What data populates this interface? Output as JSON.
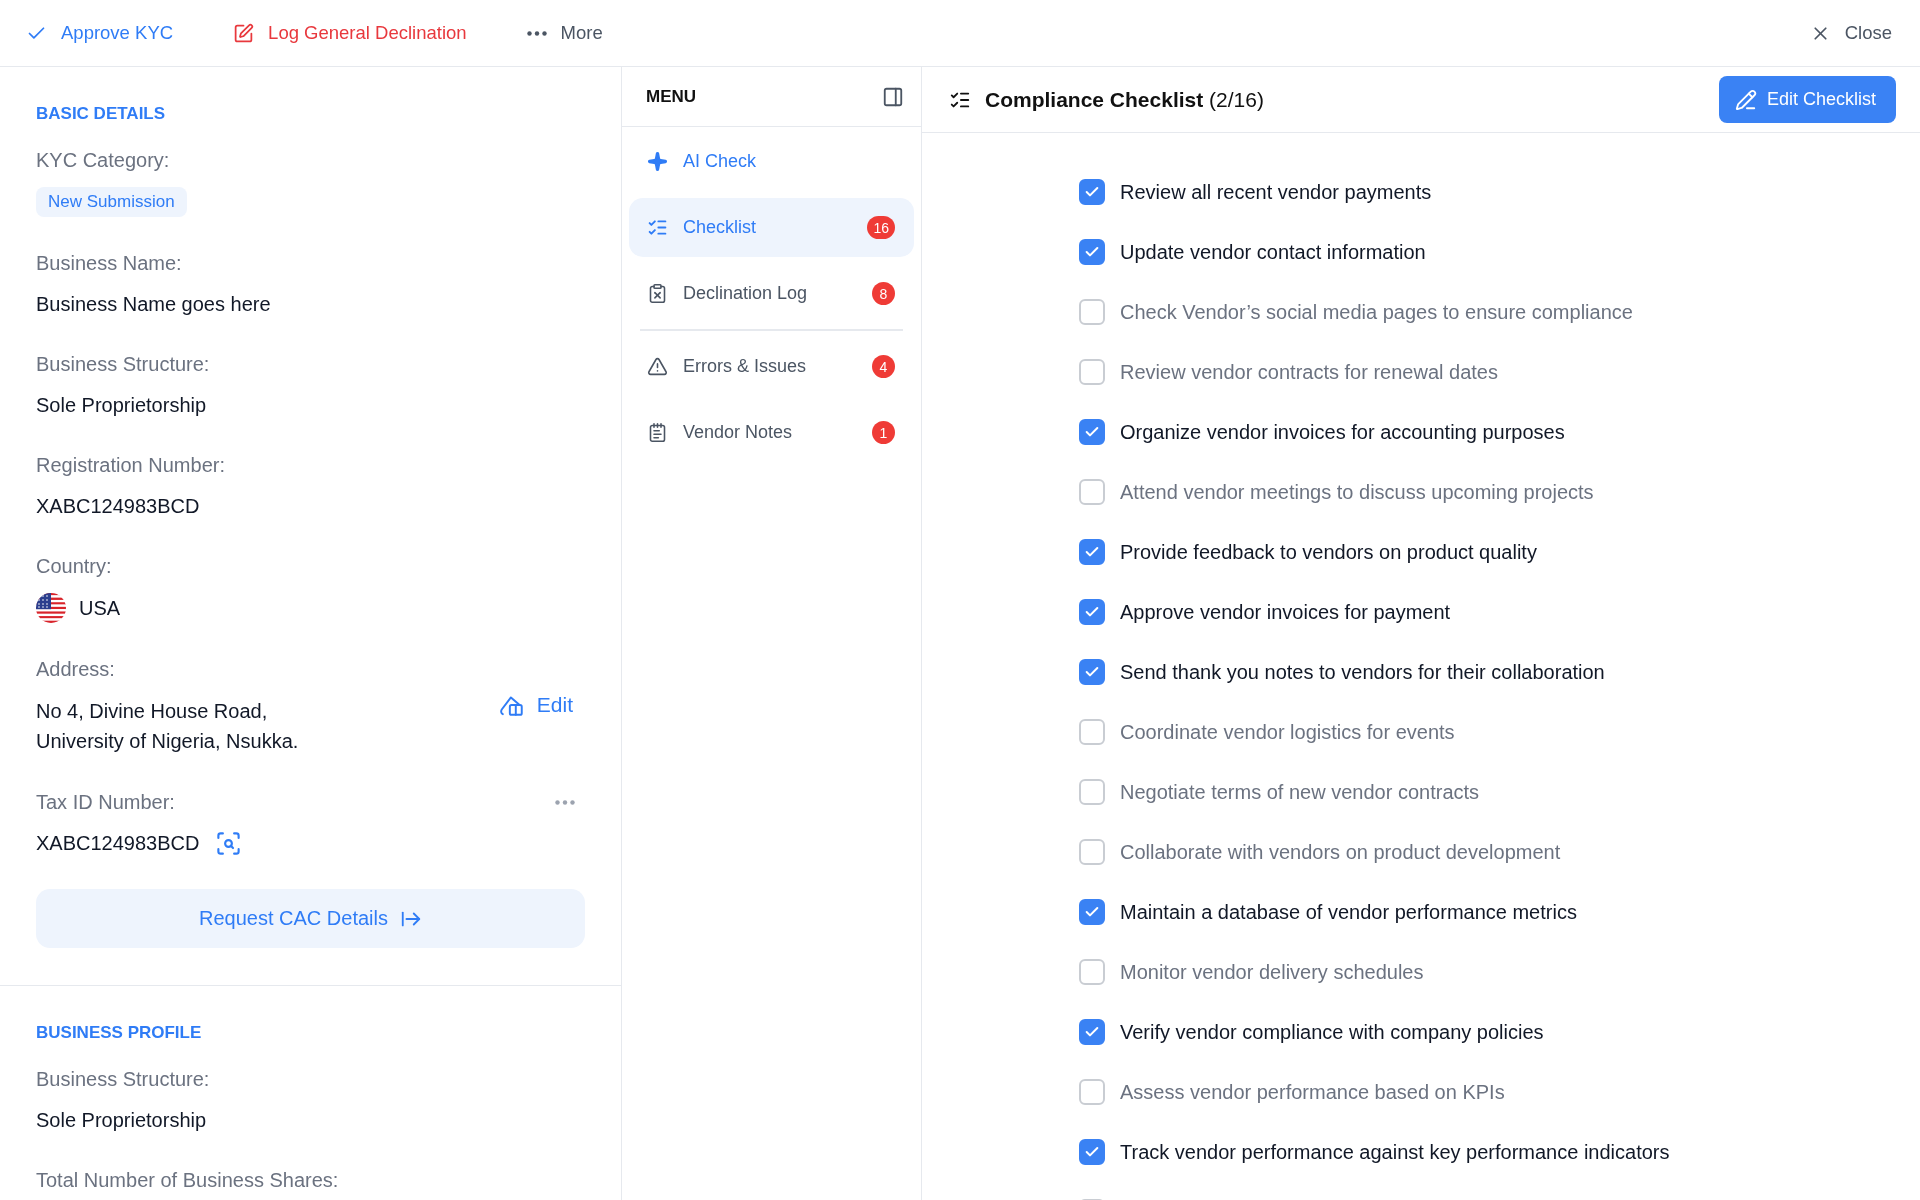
{
  "toolbar": {
    "actions": [
      {
        "kind": "approve",
        "label": "Approve KYC"
      },
      {
        "kind": "decline",
        "label": "Log General Declination"
      },
      {
        "kind": "more",
        "label": "More"
      }
    ],
    "close": "Close"
  },
  "details": {
    "sections": [
      {
        "title": "BASIC DETAILS",
        "fields": [
          {
            "kind": "badge",
            "label": "KYC Category:",
            "value": "New Submission"
          },
          {
            "kind": "text",
            "label": "Business Name:",
            "value": "Business Name goes here"
          },
          {
            "kind": "text",
            "label": "Business Structure:",
            "value": "Sole Proprietorship"
          },
          {
            "kind": "text",
            "label": "Registration Number:",
            "value": "XABC124983BCD"
          },
          {
            "kind": "country",
            "label": "Country:",
            "value": "USA"
          },
          {
            "kind": "address",
            "label": "Address:",
            "lines": [
              "No 4, Divine House Road,",
              "University of Nigeria, Nsukka."
            ],
            "action": "Edit"
          },
          {
            "kind": "tax",
            "label": "Tax ID Number:",
            "value": "XABC124983BCD"
          }
        ],
        "button": "Request CAC Details"
      },
      {
        "title": "BUSINESS PROFILE",
        "fields": [
          {
            "kind": "text",
            "label": "Business Structure:",
            "value": "Sole Proprietorship"
          },
          {
            "kind": "text",
            "label": "Total Number of Business Shares:"
          }
        ]
      }
    ]
  },
  "menu": {
    "title": "MENU",
    "groups": [
      [
        {
          "kind": "ai",
          "label": "AI Check",
          "selected": false
        },
        {
          "kind": "checklist",
          "label": "Checklist",
          "count": "16",
          "selected": true
        },
        {
          "kind": "declination",
          "label": "Declination Log",
          "count": "8",
          "selected": false
        }
      ],
      [
        {
          "kind": "errors",
          "label": "Errors & Issues",
          "count": "4",
          "selected": false
        },
        {
          "kind": "notes",
          "label": "Vendor Notes",
          "count": "1",
          "selected": false
        }
      ]
    ]
  },
  "checklist": {
    "title": "**Compliance Checklist** (2/16)",
    "edit_button": "Edit Checklist",
    "items": [
      {
        "label": "Review all recent vendor payments",
        "checked": true
      },
      {
        "label": "Update vendor contact information",
        "checked": true
      },
      {
        "label": "Check Vendor’s social media pages to ensure compliance",
        "checked": false
      },
      {
        "label": "Review vendor contracts for renewal dates",
        "checked": false
      },
      {
        "label": "Organize vendor invoices for accounting purposes",
        "checked": true
      },
      {
        "label": "Attend vendor meetings to discuss upcoming projects",
        "checked": false
      },
      {
        "label": "Provide feedback to vendors on product quality",
        "checked": true
      },
      {
        "label": "Approve vendor invoices for payment",
        "checked": true
      },
      {
        "label": "Send thank you notes to vendors for their collaboration",
        "checked": true
      },
      {
        "label": "Coordinate vendor logistics for events",
        "checked": false
      },
      {
        "label": "Negotiate terms of new vendor contracts",
        "checked": false
      },
      {
        "label": "Collaborate with vendors on product development",
        "checked": false
      },
      {
        "label": "Maintain a database of vendor performance metrics",
        "checked": true
      },
      {
        "label": "Monitor vendor delivery schedules",
        "checked": false
      },
      {
        "label": "Verify vendor compliance with company policies",
        "checked": true
      },
      {
        "label": "Assess vendor performance based on KPIs",
        "checked": false
      },
      {
        "label": "Track vendor performance against key performance indicators",
        "checked": true
      },
      {
        "checked": false
      }
    ]
  }
}
